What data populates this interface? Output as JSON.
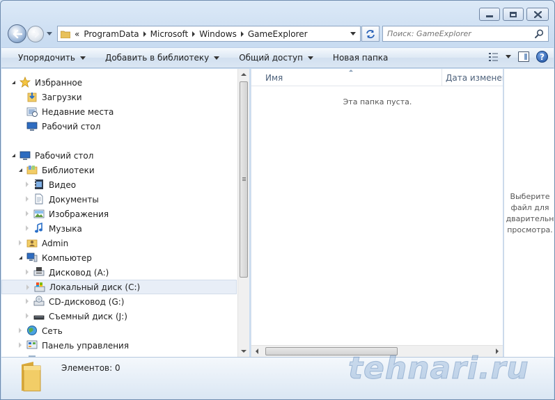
{
  "window": {
    "caption_buttons": {
      "minimize": "minimize",
      "maximize": "maximize",
      "close": "close"
    }
  },
  "navigation": {
    "back_icon": "back-arrow-icon",
    "forward_icon": "forward-arrow-icon",
    "overflow_chevron": "«",
    "breadcrumb": [
      "ProgramData",
      "Microsoft",
      "Windows",
      "GameExplorer"
    ],
    "search_placeholder": "Поиск: GameExplorer"
  },
  "toolbar": {
    "organize": "Упорядочить",
    "add_to_library": "Добавить в библиотеку",
    "share": "Общий доступ",
    "new_folder": "Новая папка"
  },
  "nav_tree": [
    {
      "label": "Избранное",
      "icon": "star-icon",
      "level": 0,
      "expander": "open"
    },
    {
      "label": "Загрузки",
      "icon": "downloads-icon",
      "level": 1,
      "expander": "none"
    },
    {
      "label": "Недавние места",
      "icon": "recent-places-icon",
      "level": 1,
      "expander": "none"
    },
    {
      "label": "Рабочий стол",
      "icon": "desktop-icon",
      "level": 1,
      "expander": "none"
    },
    {
      "label": "",
      "icon": "",
      "level": 0,
      "expander": "spacer"
    },
    {
      "label": "Рабочий стол",
      "icon": "desktop-icon",
      "level": 0,
      "expander": "open"
    },
    {
      "label": "Библиотеки",
      "icon": "libraries-icon",
      "level": 1,
      "expander": "open"
    },
    {
      "label": "Видео",
      "icon": "video-icon",
      "level": 2,
      "expander": "closed"
    },
    {
      "label": "Документы",
      "icon": "documents-icon",
      "level": 2,
      "expander": "closed"
    },
    {
      "label": "Изображения",
      "icon": "pictures-icon",
      "level": 2,
      "expander": "closed"
    },
    {
      "label": "Музыка",
      "icon": "music-icon",
      "level": 2,
      "expander": "closed"
    },
    {
      "label": "Admin",
      "icon": "user-folder-icon",
      "level": 1,
      "expander": "closed"
    },
    {
      "label": "Компьютер",
      "icon": "computer-icon",
      "level": 1,
      "expander": "open"
    },
    {
      "label": "Дисковод (A:)",
      "icon": "floppy-drive-icon",
      "level": 2,
      "expander": "closed"
    },
    {
      "label": "Локальный диск (C:)",
      "icon": "local-disk-icon",
      "level": 2,
      "expander": "closed",
      "selected": true
    },
    {
      "label": "CD-дисковод (G:)",
      "icon": "cd-drive-icon",
      "level": 2,
      "expander": "closed"
    },
    {
      "label": "Съемный диск (J:)",
      "icon": "removable-disk-icon",
      "level": 2,
      "expander": "closed"
    },
    {
      "label": "Сеть",
      "icon": "network-icon",
      "level": 1,
      "expander": "closed"
    },
    {
      "label": "Панель управления",
      "icon": "control-panel-icon",
      "level": 1,
      "expander": "closed"
    },
    {
      "label": "",
      "icon": "recycle-bin-icon",
      "level": 1,
      "expander": "none"
    }
  ],
  "content": {
    "columns": [
      "Имя",
      "Дата изменени"
    ],
    "empty_message": "Эта папка пуста."
  },
  "preview": {
    "message": "Выберите\nфайл для\nдварительн\nпросмотра."
  },
  "details": {
    "item_count": "Элементов: 0",
    "watermark": "tehnari.ru"
  },
  "colors": {
    "chrome": "#c9dcf1",
    "selection": "#e8eef7",
    "folder": "#e8c15a"
  }
}
